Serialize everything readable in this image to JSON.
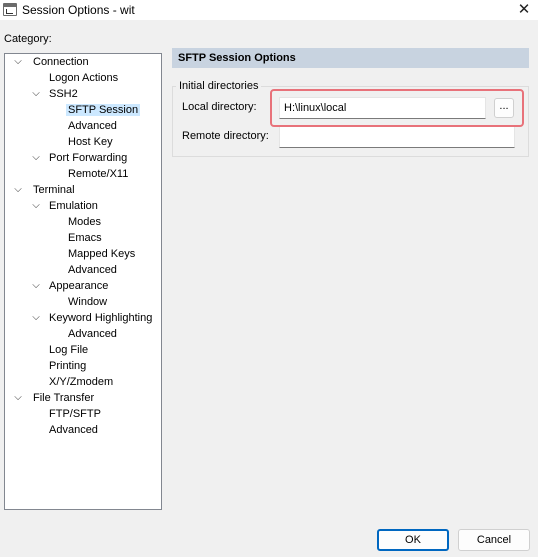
{
  "window": {
    "title": "Session Options - wit",
    "close_glyph": "✕"
  },
  "category": {
    "label": "Category:",
    "tree": [
      {
        "label": "Connection",
        "expanded": true
      },
      {
        "label": "Logon Actions"
      },
      {
        "label": "SSH2",
        "expanded": true
      },
      {
        "label": "SFTP Session",
        "selected": true
      },
      {
        "label": "Advanced"
      },
      {
        "label": "Host Key"
      },
      {
        "label": "Port Forwarding",
        "expanded": true
      },
      {
        "label": "Remote/X11"
      },
      {
        "label": "Terminal",
        "expanded": true
      },
      {
        "label": "Emulation",
        "expanded": true
      },
      {
        "label": "Modes"
      },
      {
        "label": "Emacs"
      },
      {
        "label": "Mapped Keys"
      },
      {
        "label": "Advanced"
      },
      {
        "label": "Appearance",
        "expanded": true
      },
      {
        "label": "Window"
      },
      {
        "label": "Keyword Highlighting",
        "expanded": true
      },
      {
        "label": "Advanced"
      },
      {
        "label": "Log File"
      },
      {
        "label": "Printing"
      },
      {
        "label": "X/Y/Zmodem"
      },
      {
        "label": "File Transfer",
        "expanded": true
      },
      {
        "label": "FTP/SFTP"
      },
      {
        "label": "Advanced"
      }
    ]
  },
  "panel": {
    "title": "SFTP Session Options",
    "group_label": "Initial directories",
    "local_dir_label": "Local directory:",
    "local_dir_value": "H:\\linux\\local",
    "browse_label": "...",
    "remote_dir_label": "Remote directory:",
    "remote_dir_value": ""
  },
  "buttons": {
    "ok": "OK",
    "cancel": "Cancel"
  },
  "colors": {
    "selection": "#cce8ff",
    "header_bg": "#c8d3e0",
    "highlight": "#e8727a",
    "default_button_border": "#0067c0"
  }
}
